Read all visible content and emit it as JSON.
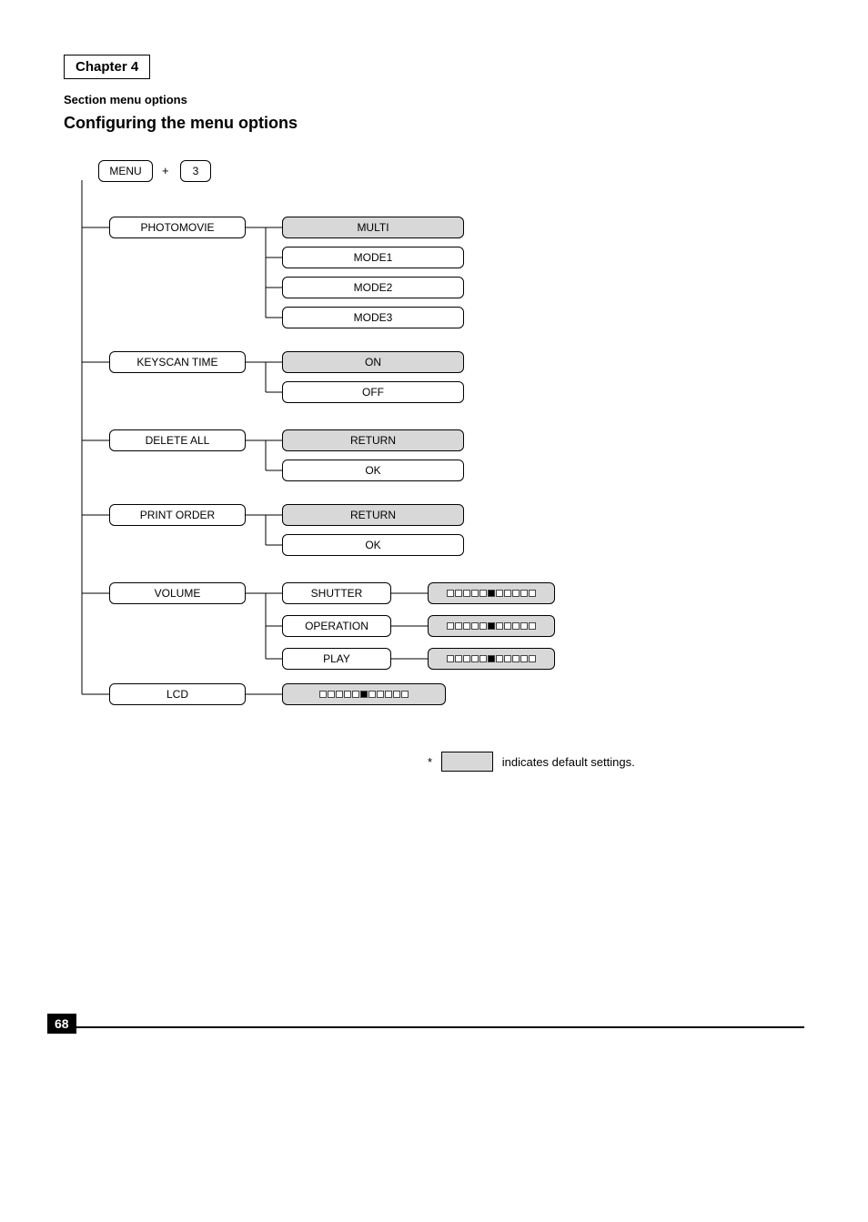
{
  "section_chapter": "Chapter 4",
  "section_label": "Section",
  "section_name": "menu options",
  "title": "Configuring the menu options",
  "root": {
    "button_menu": "MENU",
    "plus": "+",
    "button_3": "3"
  },
  "nodes": {
    "photomovie": "PHOTOMOVIE",
    "photomovie_opts": [
      "MULTI",
      "MODE1",
      "MODE2",
      "MODE3"
    ],
    "keyscan": "KEYSCAN TIME",
    "keyscan_opts": [
      "ON",
      "OFF"
    ],
    "delete": "DELETE ALL",
    "delete_opts": [
      "RETURN",
      "OK"
    ],
    "print_order": "PRINT ORDER",
    "print_order_opts": [
      "RETURN",
      "OK"
    ],
    "volume": "VOLUME",
    "volume_opts": [
      "SHUTTER",
      "OPERATION",
      "PLAY"
    ],
    "lcd": "LCD",
    "note_text": "indicates default settings.",
    "page": "68"
  }
}
